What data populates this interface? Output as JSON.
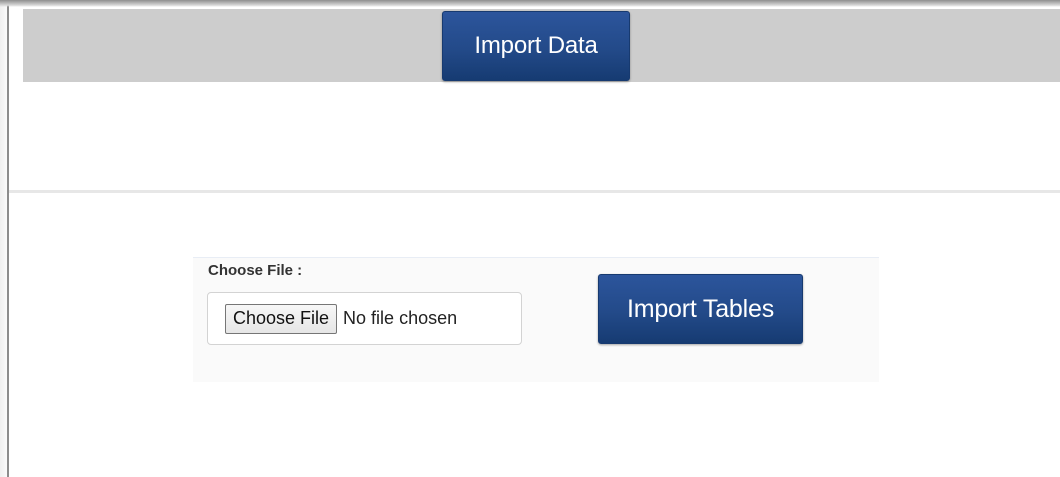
{
  "header": {
    "import_data_label": "Import Data"
  },
  "form": {
    "choose_file_label": "Choose File :",
    "file_picker_button": "Choose File",
    "file_picker_status": "No file chosen",
    "import_tables_label": "Import Tables"
  },
  "colors": {
    "button_primary": "#234a89",
    "header_band": "#cdcdcd",
    "panel": "#fafafa"
  }
}
